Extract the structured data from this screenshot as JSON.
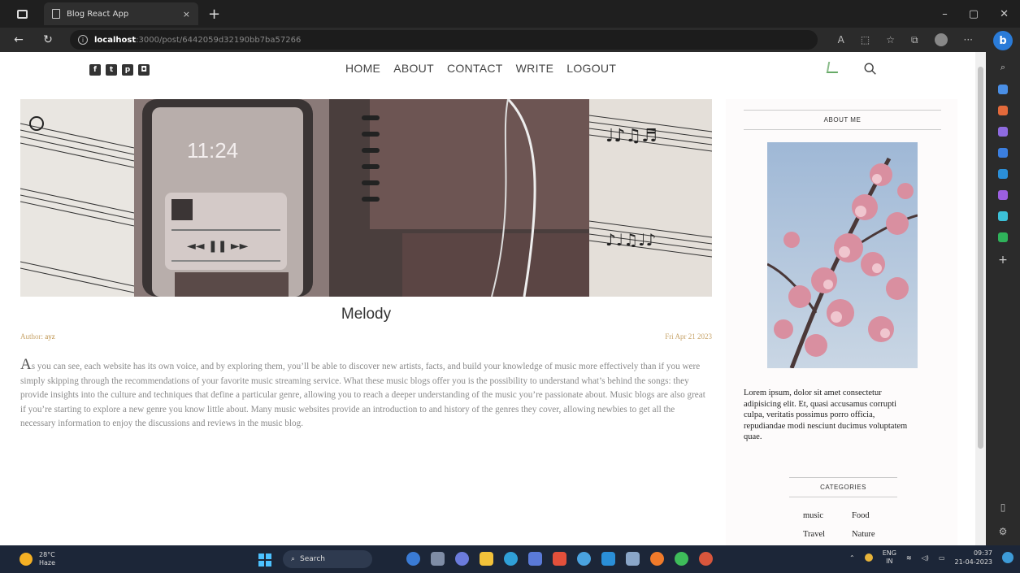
{
  "browser": {
    "tab_title": "Blog React App",
    "tab_close": "×",
    "new_tab": "+",
    "url_host": "localhost",
    "url_path": ":3000/post/6442059d32190bb7ba57266",
    "controls": {
      "minimize": "–",
      "restore": "▢",
      "close": "✕"
    },
    "back": "←",
    "reload": "↻",
    "edge_more": "···",
    "bing_label": "b"
  },
  "blog": {
    "menu": [
      {
        "label": "HOME"
      },
      {
        "label": "ABOUT"
      },
      {
        "label": "CONTACT"
      },
      {
        "label": "WRITE"
      },
      {
        "label": "LOGOUT"
      }
    ],
    "post": {
      "title": "Melody",
      "author_label": "Author: ",
      "author_name": "ayz",
      "date": "Fri Apr 21 2023",
      "drop_letter": "A",
      "desc": "s you can see, each website has its own voice, and by exploring them, you’ll be able to discover new artists, facts, and build your knowledge of music more effectively than if you were simply skipping through the recommendations of your favorite music streaming service. What these music blogs offer you is the possibility to understand what’s behind the songs: they provide insights into the culture and techniques that define a particular genre, allowing you to reach a deeper understanding of the music you’re passionate about. Music blogs are also great if you’re starting to explore a new genre you know little about. Many music websites provide an introduction to and history of the genres they cover, allowing newbies to get all the necessary information to enjoy the discussions and reviews in the music blog."
    },
    "sidebar": {
      "about_title": "ABOUT ME",
      "about_text": "Lorem ipsum, dolor sit amet consectetur adipisicing elit. Et, quasi accusamus corrupti culpa, veritatis possimus porro officia, repudiandae modi nesciunt ducimus voluptatem quae.",
      "categories_title": "CATEGORIES",
      "categories": [
        "music",
        "Food",
        "Travel",
        "Nature"
      ]
    },
    "phone_time": "11:24"
  },
  "taskbar": {
    "temp": "28°C",
    "weather": "Haze",
    "search": "Search",
    "lang_top": "ENG",
    "lang_bottom": "IN",
    "time": "09:37",
    "date": "21-04-2023"
  },
  "colors": {
    "accent_gold": "#b88a3e",
    "start_blue": "#4cc2ff",
    "bing_blue": "#2a7bd8"
  }
}
